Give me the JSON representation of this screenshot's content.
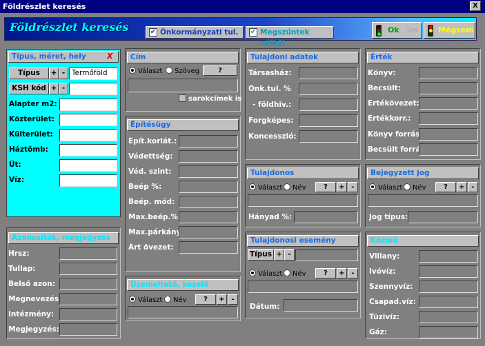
{
  "window": {
    "title": "Földrészlet keresés",
    "close": "X"
  },
  "banner": {
    "title": "Földrészlet keresés",
    "check_onkormanyzati": "Önkormányzati tul.",
    "check_megszuntek": "Megszűntek nélkül",
    "ok_label": "Ok",
    "ok_extra": "Erre",
    "cancel_label": "Mégsem"
  },
  "tipus_panel": {
    "title": "Típus, méret, hely",
    "close": "X",
    "tipus_label": "Típus",
    "tipus_value": "Termőföld",
    "ksh_label": "KSH kód",
    "plus": "+",
    "minus": "-",
    "fields": [
      "Alapter m2:",
      "Közterület:",
      "Külterület:",
      "Háztömb:",
      "Út:",
      "Víz:"
    ]
  },
  "cim_panel": {
    "title": "Cím",
    "radio_valaszt": "Választ",
    "radio_szoveg": "Szöveg",
    "question": "?",
    "sarok": "sarokcímek is"
  },
  "epites_panel": {
    "title": "Építésügy",
    "fields": [
      "Épít.korlát.:",
      "Védettség:",
      "Véd. szint:",
      "Beép %:",
      "Beép. mód:",
      "Max.beép.%:",
      "Max.párkány:",
      "Árt övezet:"
    ]
  },
  "uzem_panel": {
    "title": "Üzemeltető, kezelő",
    "radio_valaszt": "Választ",
    "radio_nev": "Név",
    "question": "?",
    "plus": "+",
    "minus": "-"
  },
  "azon_panel": {
    "title": "Azonosítók, megjegyzés",
    "fields": [
      "Hrsz:",
      "Tullap:",
      "Belső azon:",
      "Megnevezés:",
      "Intézmény:",
      "Megjegyzés:"
    ]
  },
  "tul_adatok_panel": {
    "title": "Tulajdoni adatok",
    "fields": [
      "Társasház:",
      "Önk.tul. %",
      "  - földhiv.:",
      "Forgképes:",
      "Koncesszió:"
    ]
  },
  "tulajdonos_panel": {
    "title": "Tulajdonos",
    "radio_valaszt": "Választ",
    "radio_nev": "Név",
    "question": "?",
    "plus": "+",
    "minus": "-",
    "hanyad": "Hányad %:"
  },
  "esemeny_panel": {
    "title": "Tulajdonosi esemény",
    "tipus": "Típus",
    "plus": "+",
    "minus": "-",
    "radio_valaszt": "Választ",
    "radio_nev": "Név",
    "question": "?",
    "datum": "Dátum:"
  },
  "ertek_panel": {
    "title": "Érték",
    "fields": [
      "Könyv:",
      "Becsült:",
      "Értékövezet:",
      "Értékkorr.:",
      "Könyv forrás:",
      "Becsült forrás:"
    ]
  },
  "bejegyzett_panel": {
    "title": "Bejegyzett jog",
    "radio_valaszt": "Választ",
    "radio_nev": "Név",
    "question": "?",
    "plus": "+",
    "minus": "-",
    "jog_tipus": "Jog típus:"
  },
  "kozmu_panel": {
    "title": "Közmű",
    "fields": [
      "Villany:",
      "Ivóvíz:",
      "Szennyvíz:",
      "Csapad.víz:",
      "Tüzivíz:",
      "Gáz:"
    ]
  },
  "colors": {
    "titlebar": "#000080",
    "cyan": "#00ffff",
    "panel": "#808080",
    "accent": "#1a6ae0"
  }
}
